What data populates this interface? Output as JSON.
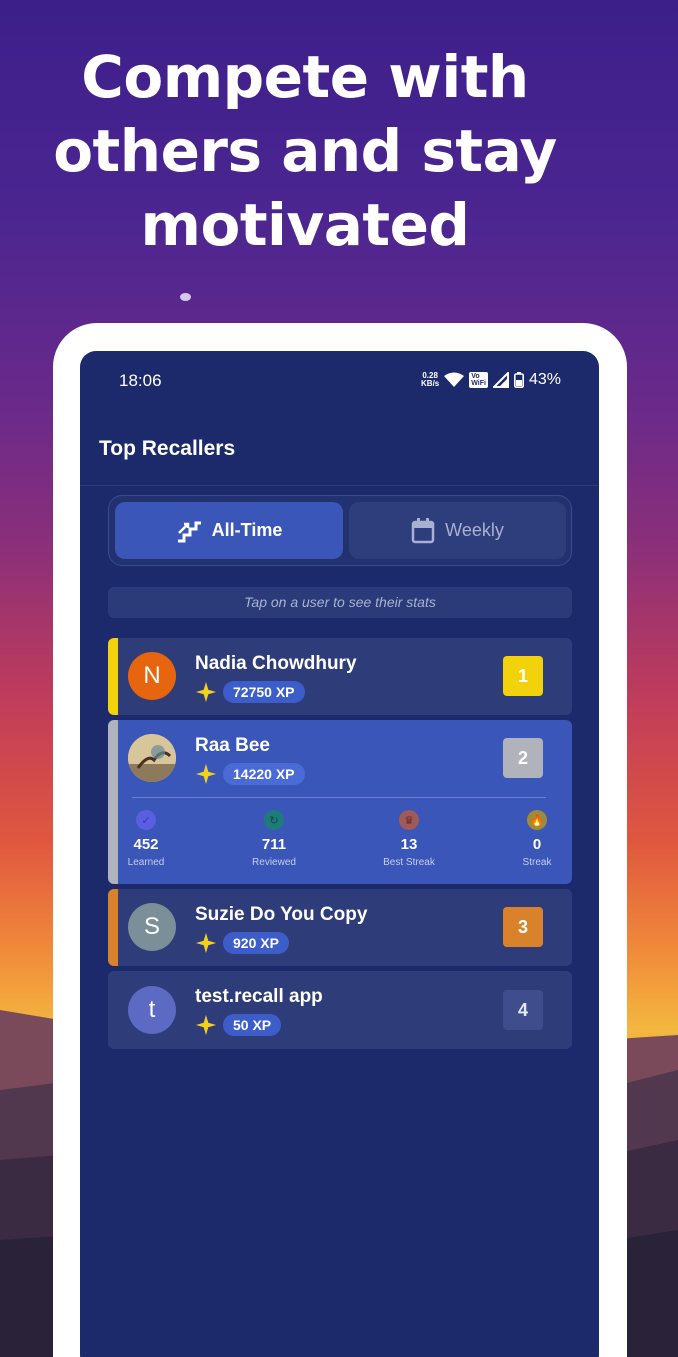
{
  "headline": "Compete with others and stay motivated",
  "status": {
    "time": "18:06",
    "speed_value": "0.28",
    "speed_unit": "KB/s",
    "vowifi_line1": "Vo",
    "vowifi_line2": "WiFi",
    "battery": "43%"
  },
  "appbar": {
    "title": "Top Recallers"
  },
  "tabs": {
    "all_time": "All-Time",
    "weekly": "Weekly"
  },
  "hint": "Tap on a user to see their stats",
  "users": [
    {
      "initial": "N",
      "name": "Nadia Chowdhury",
      "xp": "72750 XP",
      "rank": "1"
    },
    {
      "initial": "",
      "name": "Raa Bee",
      "xp": "14220 XP",
      "rank": "2"
    },
    {
      "initial": "S",
      "name": "Suzie Do You Copy",
      "xp": "920 XP",
      "rank": "3"
    },
    {
      "initial": "t",
      "name": "test.recall app",
      "xp": "50 XP",
      "rank": "4"
    }
  ],
  "expanded_stats": [
    {
      "value": "452",
      "label": "Learned",
      "icon": "check-icon"
    },
    {
      "value": "711",
      "label": "Reviewed",
      "icon": "review-icon"
    },
    {
      "value": "13",
      "label": "Best Streak",
      "icon": "crown-icon"
    },
    {
      "value": "0",
      "label": "Streak",
      "icon": "flame-icon"
    }
  ],
  "colors": {
    "screen_bg": "#1c2a6b",
    "gold": "#f2d20a",
    "silver": "#b0b3bb",
    "bronze": "#d9822b",
    "selected_tab": "#3a56b8"
  }
}
